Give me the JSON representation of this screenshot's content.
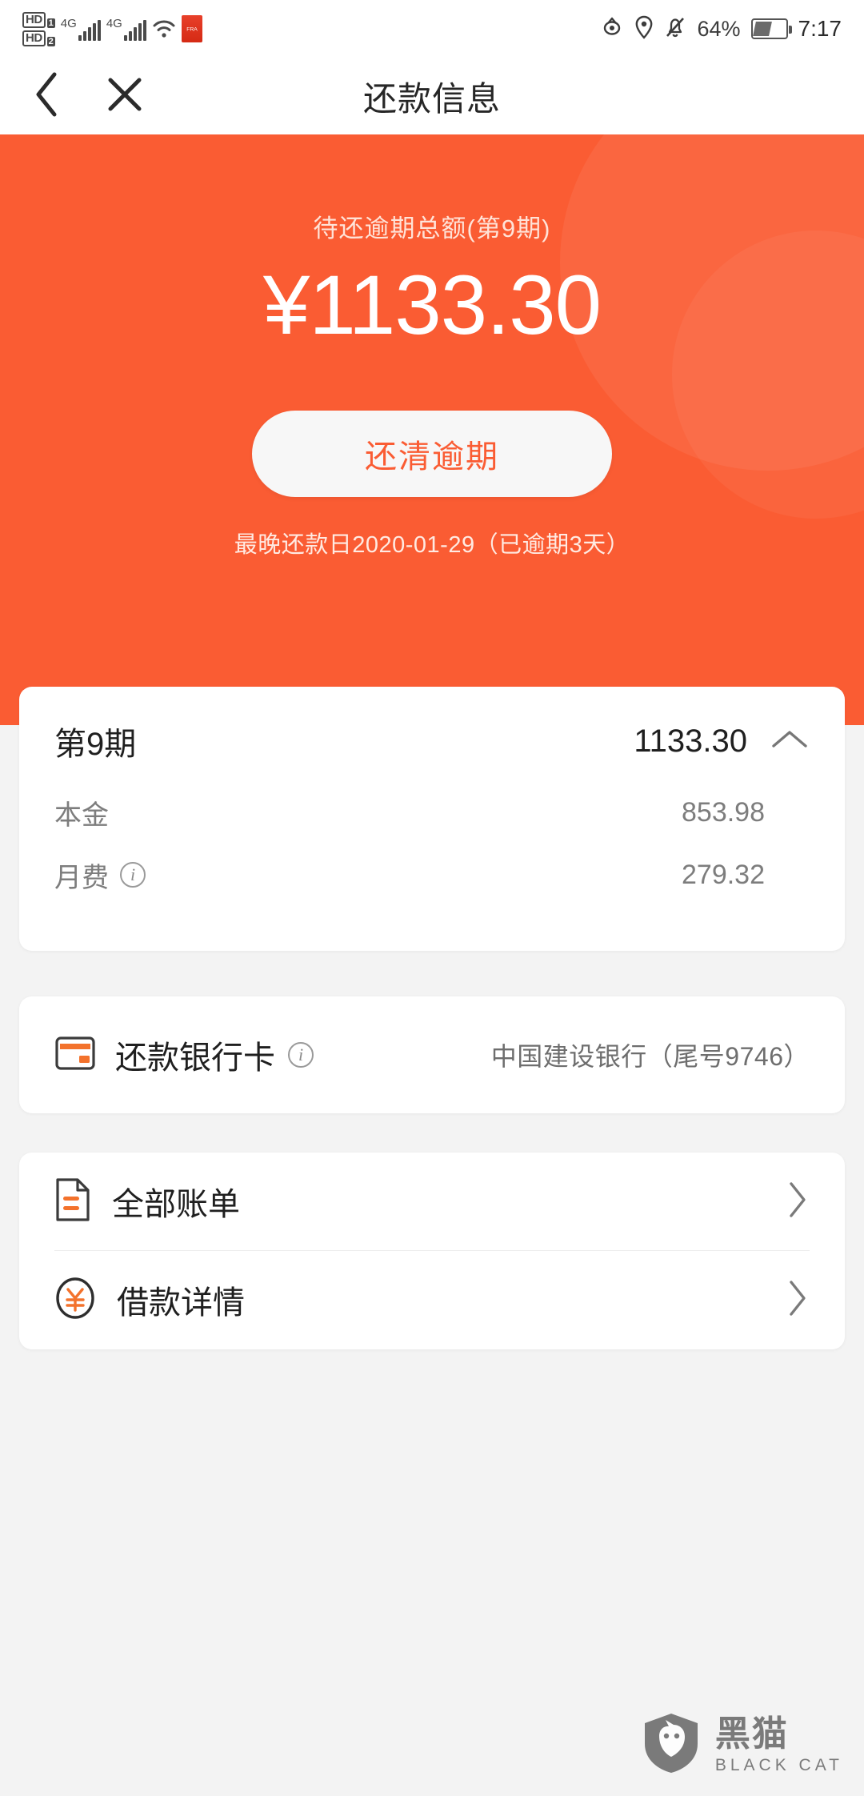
{
  "status_bar": {
    "hd1": "HD",
    "hd1_sub": "1",
    "hd2": "HD",
    "hd2_sub": "2",
    "net1": "4G",
    "net2": "4G",
    "app_badge": "FRA",
    "battery_percent": "64%",
    "time": "7:17",
    "icons": [
      "eye-icon",
      "location-icon",
      "bell-muted-icon",
      "battery-icon"
    ]
  },
  "nav": {
    "back_icon": "chevron-left-icon",
    "close_icon": "close-icon",
    "title": "还款信息"
  },
  "hero": {
    "label": "待还逾期总额(第9期)",
    "amount": "¥1133.30",
    "button_label": "还清逾期",
    "due_text": "最晚还款日2020-01-29（已逾期3天）",
    "bg_color": "#fa5c33",
    "button_text_color": "#fa5c33"
  },
  "installment": {
    "title": "第9期",
    "amount": "1133.30",
    "toggle_icon": "chevron-up-icon",
    "rows": [
      {
        "label": "本金",
        "value": "853.98",
        "has_info": false
      },
      {
        "label": "月费",
        "value": "279.32",
        "has_info": true
      }
    ]
  },
  "bank": {
    "icon": "bank-card-icon",
    "label": "还款银行卡",
    "has_info": true,
    "value": "中国建设银行（尾号9746）"
  },
  "links": [
    {
      "icon": "document-icon",
      "label": "全部账单",
      "chevron": "chevron-right-icon"
    },
    {
      "icon": "yuan-circle-icon",
      "label": "借款详情",
      "chevron": "chevron-right-icon"
    }
  ],
  "watermark": {
    "logo_icon": "black-cat-logo",
    "cn": "黑猫",
    "en": "BLACK CAT"
  }
}
